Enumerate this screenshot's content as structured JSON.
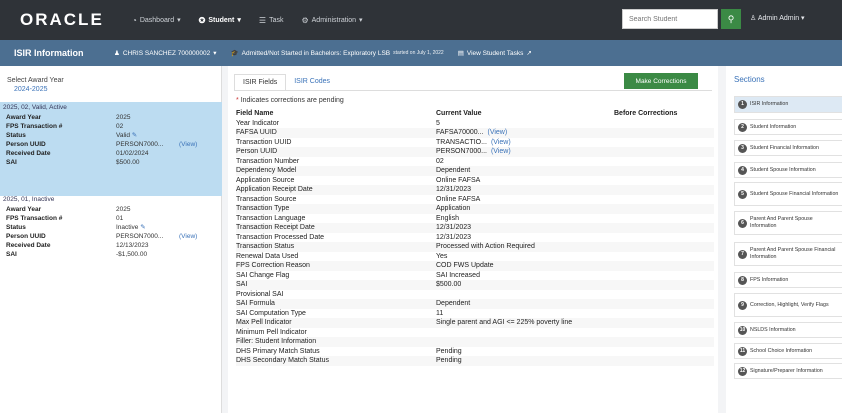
{
  "nav": {
    "logo": "ORACLE",
    "items": [
      {
        "label": "Dashboard",
        "icon": "dashboard-icon",
        "active": false,
        "caret": true
      },
      {
        "label": "Student",
        "icon": "student-icon",
        "active": true,
        "caret": true
      },
      {
        "label": "Task",
        "icon": "task-icon",
        "active": false,
        "caret": false
      },
      {
        "label": "Administration",
        "icon": "gear-icon",
        "active": false,
        "caret": true
      }
    ],
    "search_placeholder": "Search Student",
    "admin_label": "Admin Admin"
  },
  "subheader": {
    "title": "ISIR Information",
    "student": "CHRIS SANCHEZ 700000002",
    "status": "Admitted/Not Started in Bachelors: Exploratory LSB",
    "status_small": "started on July 1, 2022",
    "tasks_link": "View Student Tasks"
  },
  "left": {
    "label": "Select Award Year",
    "year": "2024-2025",
    "blocks": [
      {
        "head": "2025, 02, Valid, Active",
        "rows": [
          {
            "k": "Award Year",
            "v": "2025",
            "view": ""
          },
          {
            "k": "FPS Transaction #",
            "v": "02",
            "view": ""
          },
          {
            "k": "Status",
            "v": "Valid",
            "view": ""
          },
          {
            "k": "Person UUID",
            "v": "PERSON7000...",
            "view": "(View)"
          },
          {
            "k": "Received Date",
            "v": "01/02/2024",
            "view": ""
          },
          {
            "k": "SAI",
            "v": "$500.00",
            "view": ""
          }
        ]
      },
      {
        "head": "2025, 01, Inactive",
        "rows": [
          {
            "k": "Award Year",
            "v": "2025",
            "view": ""
          },
          {
            "k": "FPS Transaction #",
            "v": "01",
            "view": ""
          },
          {
            "k": "Status",
            "v": "Inactive",
            "view": ""
          },
          {
            "k": "Person UUID",
            "v": "PERSON7000...",
            "view": "(View)"
          },
          {
            "k": "Received Date",
            "v": "12/13/2023",
            "view": ""
          },
          {
            "k": "SAI",
            "v": "-$1,500.00",
            "view": ""
          }
        ]
      }
    ]
  },
  "main": {
    "tabs": [
      "ISIR Fields",
      "ISIR Codes"
    ],
    "make_corrections": "Make Corrections",
    "pending_note": "Indicates corrections are pending",
    "headers": [
      "Field Name",
      "Current Value",
      "Before Corrections"
    ],
    "rows": [
      [
        "Year Indicator",
        "5",
        ""
      ],
      [
        "FAFSA UUID",
        "FAFSA70000...",
        "(View)"
      ],
      [
        "Transaction UUID",
        "TRANSACTIO...",
        "(View)"
      ],
      [
        "Person UUID",
        "PERSON7000...",
        "(View)"
      ],
      [
        "Transaction Number",
        "02",
        ""
      ],
      [
        "Dependency Model",
        "Dependent",
        ""
      ],
      [
        "Application Source",
        "Online FAFSA",
        ""
      ],
      [
        "Application Receipt Date",
        "12/31/2023",
        ""
      ],
      [
        "Transaction Source",
        "Online FAFSA",
        ""
      ],
      [
        "Transaction Type",
        "Application",
        ""
      ],
      [
        "Transaction Language",
        "English",
        ""
      ],
      [
        "Transaction Receipt Date",
        "12/31/2023",
        ""
      ],
      [
        "Transaction Processed Date",
        "12/31/2023",
        ""
      ],
      [
        "Transaction Status",
        "Processed with Action Required",
        ""
      ],
      [
        "Renewal Data Used",
        "Yes",
        ""
      ],
      [
        "FPS Correction Reason",
        "COD FWS Update",
        ""
      ],
      [
        "SAI Change Flag",
        "SAI Increased",
        ""
      ],
      [
        "SAI",
        "$500.00",
        ""
      ],
      [
        "Provisional SAI",
        "",
        ""
      ],
      [
        "SAI Formula",
        "Dependent",
        ""
      ],
      [
        "SAI Computation Type",
        "11",
        ""
      ],
      [
        "Max Pell Indicator",
        "Single parent and AGI <= 225% poverty line",
        ""
      ],
      [
        "Minimum Pell Indicator",
        "",
        ""
      ],
      [
        "Filler: Student Information",
        "",
        ""
      ],
      [
        "DHS Primary Match Status",
        "Pending",
        ""
      ],
      [
        "DHS Secondary Match Status",
        "Pending",
        ""
      ]
    ]
  },
  "right": {
    "title": "Sections",
    "items": [
      "ISIR Information",
      "Student Information",
      "Student Financial Information",
      "Student Spouse Information",
      "Student Spouse Financial Information",
      "Parent And Parent Spouse Information",
      "Parent And Parent Spouse Financial Information",
      "FPS Information",
      "Correction, Highlight, Verify Flags",
      "NSLDS Information",
      "School Choice Information",
      "Signature/Preparer Information"
    ]
  }
}
